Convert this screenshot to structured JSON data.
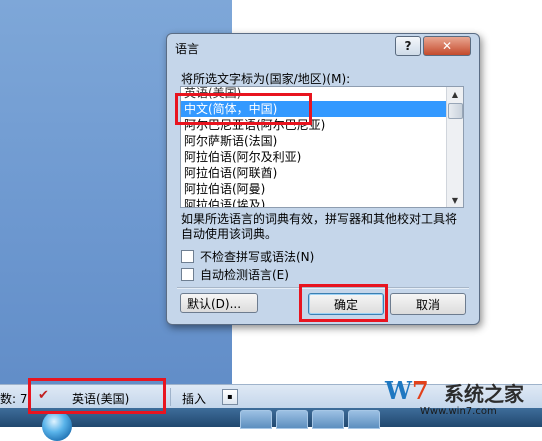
{
  "dialog": {
    "title": "语言",
    "help_label": "?",
    "close_label": "✕",
    "prompt": "将所选文字标为(国家/地区)(M):",
    "languages": [
      "英语(美国)",
      "中文(简体，中国)",
      "阿尔巴尼亚语(阿尔巴尼亚)",
      "阿尔萨斯语(法国)",
      "阿拉伯语(阿尔及利亚)",
      "阿拉伯语(阿联酋)",
      "阿拉伯语(阿曼)",
      "阿拉伯语(埃及)"
    ],
    "selected_language": "中文(简体，中国)",
    "note": "如果所选语言的词典有效，拼写器和其他校对工具将自动使用该词典。",
    "checkbox_no_proofing": "不检查拼写或语法(N)",
    "checkbox_detect": "自动检测语言(E)",
    "button_default": "默认(D)...",
    "button_ok": "确定",
    "button_cancel": "取消"
  },
  "statusbar": {
    "word_count": "数: 7",
    "language": "英语(美国)",
    "insert_mode": "插入"
  },
  "watermark": {
    "logo_w": "W",
    "logo_7": "7",
    "text": "系统之家",
    "url": "Www.win7.com"
  },
  "colors": {
    "selection": "#3399ff",
    "highlight": "#e8141f",
    "dialog_bg": "#c5d6ea"
  }
}
